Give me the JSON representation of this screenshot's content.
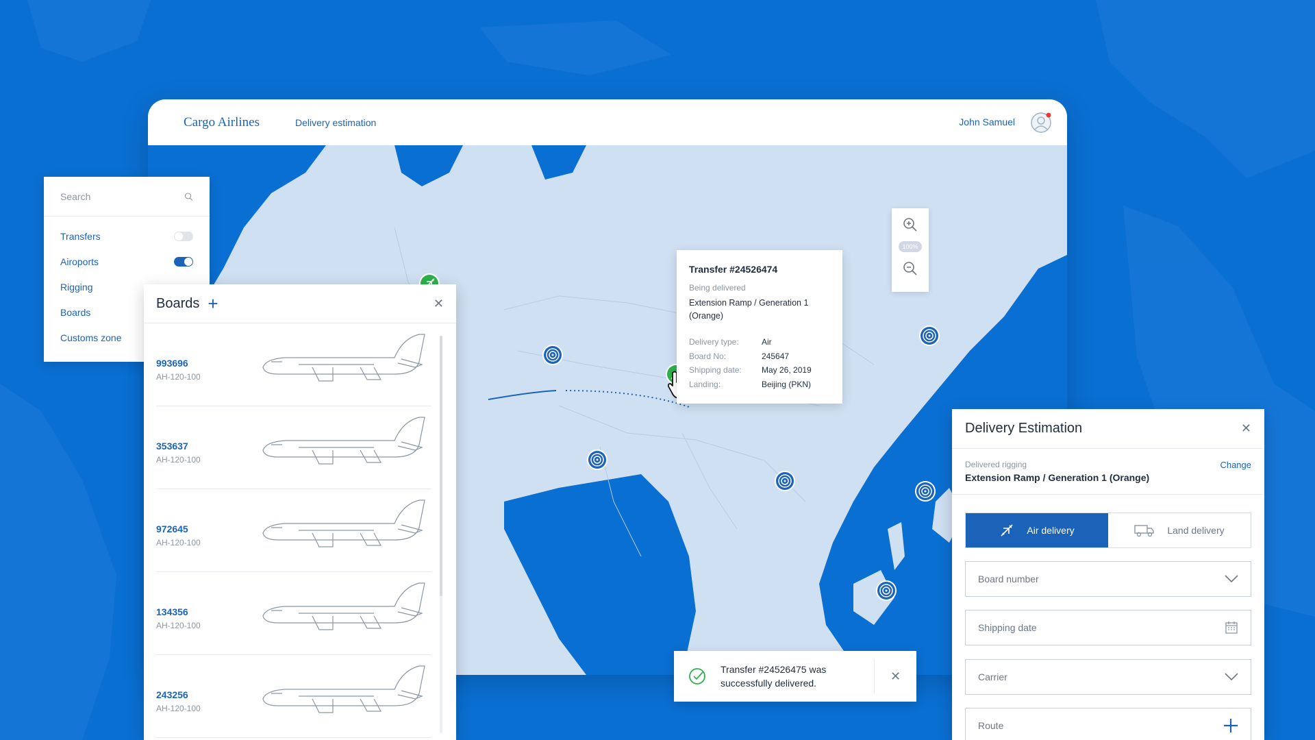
{
  "header": {
    "brand": "Cargo Airlines",
    "nav_link": "Delivery estimation",
    "user_name": "John Samuel"
  },
  "zoom": {
    "level": "100%"
  },
  "tooltip": {
    "title": "Transfer #24526474",
    "status": "Being delivered",
    "item": "Extension Ramp / Generation 1 (Orange)",
    "rows": [
      {
        "label": "Delivery type:",
        "value": "Air"
      },
      {
        "label": "Board No:",
        "value": "245647"
      },
      {
        "label": "Shipping date:",
        "value": "May 26, 2019"
      },
      {
        "label": "Landing:",
        "value": "Beijing (PKN)"
      }
    ]
  },
  "side": {
    "search_placeholder": "Search",
    "filters": [
      {
        "label": "Transfers",
        "on": false
      },
      {
        "label": "Airoports",
        "on": true
      },
      {
        "label": "Rigging",
        "on": false
      },
      {
        "label": "Boards",
        "on": false
      },
      {
        "label": "Customs zone",
        "on": false
      }
    ]
  },
  "boards": {
    "title": "Boards",
    "items": [
      {
        "number": "993696",
        "model": "AH-120-100"
      },
      {
        "number": "353637",
        "model": "AH-120-100"
      },
      {
        "number": "972645",
        "model": "AH-120-100"
      },
      {
        "number": "134356",
        "model": "AH-120-100"
      },
      {
        "number": "243256",
        "model": "AH-120-100"
      }
    ]
  },
  "toast": {
    "message": "Transfer #24526475 was successfully delivered."
  },
  "estimation": {
    "title": "Delivery Estimation",
    "rigging_label": "Delivered rigging",
    "rigging_value": "Extension Ramp / Generation 1 (Orange)",
    "change_label": "Change",
    "air_label": "Air delivery",
    "land_label": "Land delivery",
    "board_number_label": "Board number",
    "shipping_date_label": "Shipping date",
    "carrier_label": "Carrier",
    "route_label": "Route"
  },
  "colors": {
    "background": "#0a6fd2",
    "accent": "#1a63b8",
    "success": "#2bb24c",
    "map_land": "#cfe0f2"
  }
}
